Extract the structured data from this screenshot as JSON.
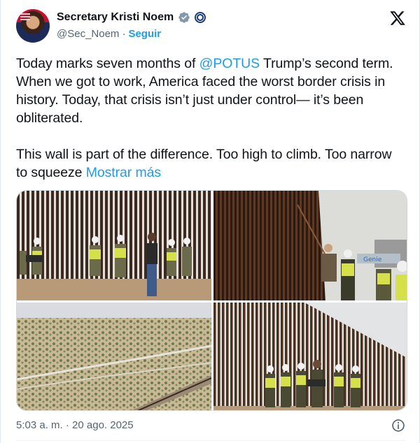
{
  "author": {
    "name": "Secretary Kristi Noem",
    "handle": "@Sec_Noem",
    "separator": "·",
    "follow_label": "Seguir"
  },
  "tweet": {
    "p1_before": "Today marks seven months of ",
    "p1_mention": "@POTUS",
    "p1_after": " Trump’s second term. When we got to work, America faced the worst border crisis in history. Today, that crisis isn’t just under control— it’s been obliterated.",
    "p2": "This wall is part of the difference. Too high to climb. Too narrow to squeeze ",
    "more_label": "Mostrar más"
  },
  "media": {
    "photo2_sign": "Genie"
  },
  "footer": {
    "timestamp": "5:03 a. m. · 20 ago. 2025"
  },
  "colors": {
    "link": "#1d9bf0",
    "secondary_text": "#536471",
    "text": "#0f1419"
  },
  "icons": [
    "verified-badge-icon",
    "government-seal-icon",
    "x-logo-icon",
    "info-icon"
  ]
}
